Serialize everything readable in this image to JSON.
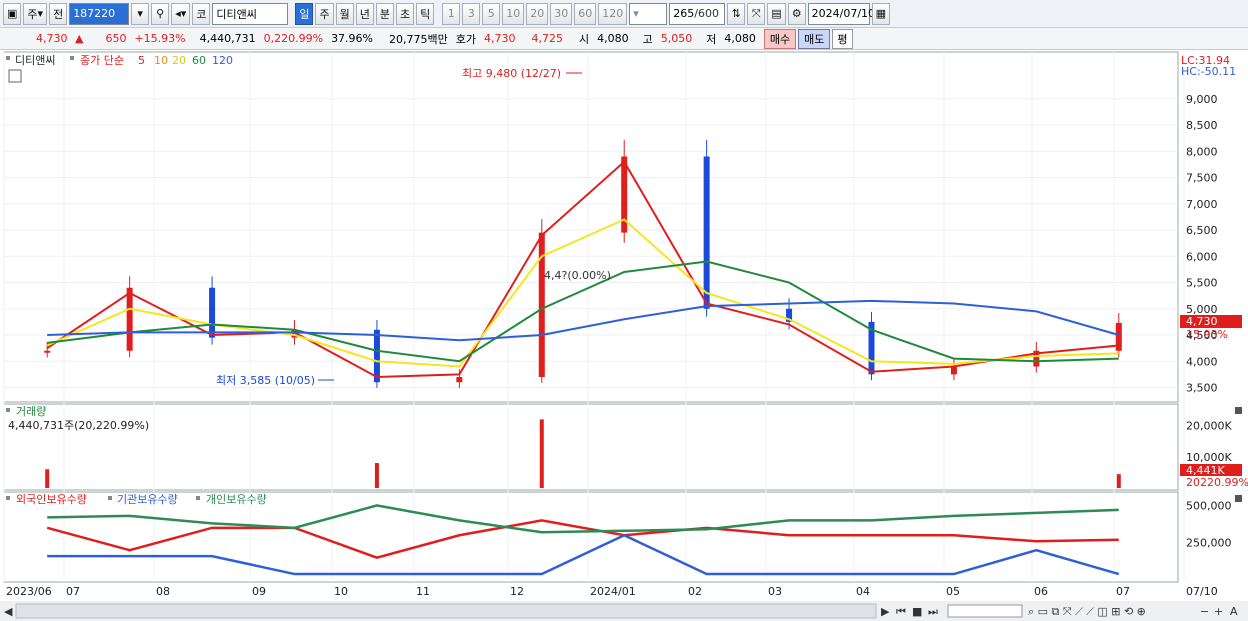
{
  "toolbar": {
    "type_label": "주",
    "prev_label": "전",
    "code_value": "187220",
    "market_label": "코",
    "stock_name": "디티앤씨",
    "periods": [
      "일",
      "주",
      "월",
      "년",
      "분",
      "초",
      "틱"
    ],
    "selected_period": "일",
    "minutes": [
      "1",
      "3",
      "5",
      "10",
      "20",
      "30",
      "60",
      "120"
    ],
    "count_value": "265",
    "count_total": "/600",
    "date_value": "2024/07/10"
  },
  "quote": {
    "price": "4,730",
    "change": "650",
    "change_pct": "+15.93%",
    "volume": "4,440,731",
    "volume_ratio": "0,220.99%",
    "turnover": "37.96%",
    "amount": "20,775백만",
    "hoga_label": "호가",
    "ask": "4,730",
    "bid": "4,725",
    "open_label": "시",
    "open": "4,080",
    "high_label": "고",
    "high": "5,050",
    "low_label": "저",
    "low": "4,080",
    "buy_label": "매수",
    "sell_label": "매도",
    "eval_label": "평"
  },
  "price_panel": {
    "legend_name": "디티앤씨",
    "legend_ma": "종가 단순",
    "ma_periods": [
      "5",
      "10",
      "20",
      "60",
      "120"
    ],
    "lc": "LC:31.94",
    "hc": "HC:-50.11",
    "high_annotation": "최고 9,480 (12/27)",
    "low_annotation": "최저 3,585 (10/05)",
    "mid_annotation": "4,4?(0.00%)",
    "current_tag": "4,730",
    "current_pct": "15.93%",
    "y_ticks": [
      "9,000",
      "8,500",
      "8,000",
      "7,500",
      "7,000",
      "6,500",
      "6,000",
      "5,500",
      "5,000",
      "4,500",
      "4,000",
      "3,500"
    ]
  },
  "volume_panel": {
    "title": "거래량",
    "value": "4,440,731주(20,220.99%)",
    "y_ticks": [
      "20,000K",
      "10,000K"
    ],
    "current_tag": "4,441K",
    "current_pct": "20220.99%"
  },
  "holding_panel": {
    "legend": [
      "외국인보유수량",
      "기관보유수량",
      "개인보유수량"
    ],
    "y_ticks": [
      "500,000",
      "250,000"
    ]
  },
  "x_axis": {
    "labels": [
      "2023/06",
      "07",
      "08",
      "09",
      "10",
      "11",
      "12",
      "2024/01",
      "02",
      "03",
      "04",
      "05",
      "06",
      "07",
      "07/10"
    ]
  },
  "colors": {
    "up": "#e01e1e",
    "down": "#1c49d8",
    "ma5": "#e01e1e",
    "ma10": "#f08a1c",
    "ma20": "#f5e61e",
    "ma60": "#1f8a3a",
    "ma120": "#2f5fd8",
    "foreign": "#e01e1e",
    "institution": "#2f5fd8",
    "individual": "#2e8b57"
  },
  "chart_data": [
    {
      "type": "line",
      "title": "디티앤씨",
      "description_series": "daily close (approx.)",
      "x": [
        "2023/06",
        "2023/07",
        "2023/08",
        "2023/09",
        "2023/10",
        "2023/11",
        "2023/12",
        "2024/01",
        "2024/02",
        "2024/03",
        "2024/04",
        "2024/05",
        "2024/06",
        "2024/07"
      ],
      "series": [
        {
          "name": "종가",
          "values": [
            4200,
            5400,
            4450,
            4600,
            3600,
            3700,
            6450,
            7900,
            5000,
            4750,
            3750,
            3900,
            4200,
            4730
          ]
        },
        {
          "name": "5",
          "values": [
            4250,
            5300,
            4500,
            4550,
            3700,
            3750,
            6400,
            7800,
            5100,
            4700,
            3800,
            3900,
            4150,
            4300
          ]
        },
        {
          "name": "20",
          "values": [
            4300,
            5000,
            4700,
            4500,
            4000,
            3900,
            6000,
            6700,
            5300,
            4800,
            4000,
            3950,
            4100,
            4150
          ]
        },
        {
          "name": "60",
          "values": [
            4350,
            4550,
            4700,
            4600,
            4200,
            4000,
            5000,
            5700,
            5900,
            5500,
            4600,
            4050,
            4000,
            4050
          ]
        },
        {
          "name": "120",
          "values": [
            4500,
            4550,
            4550,
            4550,
            4500,
            4400,
            4500,
            4800,
            5050,
            5100,
            5150,
            5100,
            4950,
            4500
          ]
        }
      ],
      "ylim": [
        3300,
        9700
      ],
      "annotations": [
        "최고 9,480 (12/27)",
        "최저 3,585 (10/05)"
      ]
    },
    {
      "type": "bar",
      "title": "거래량",
      "ylim": [
        0,
        25000
      ],
      "notable_values_k": [
        {
          "x": "2023/06",
          "value": 6000
        },
        {
          "x": "2023/10",
          "value": 8000
        },
        {
          "x": "2023/12",
          "value": 22000
        },
        {
          "x": "2024/07/10",
          "value": 4441
        }
      ]
    },
    {
      "type": "line",
      "series": [
        {
          "name": "외국인보유수량",
          "values": [
            350000,
            200000,
            350000,
            350000,
            150000,
            300000,
            400000,
            300000,
            350000,
            300000,
            300000,
            300000,
            260000,
            270000
          ]
        },
        {
          "name": "기관보유수량",
          "values": [
            160000,
            160000,
            160000,
            40000,
            40000,
            40000,
            40000,
            300000,
            40000,
            40000,
            40000,
            40000,
            200000,
            40000
          ]
        },
        {
          "name": "개인보유수량",
          "values": [
            420000,
            430000,
            380000,
            350000,
            500000,
            400000,
            320000,
            330000,
            340000,
            400000,
            400000,
            430000,
            450000,
            470000
          ]
        }
      ],
      "ylim": [
        0,
        550000
      ]
    }
  ]
}
